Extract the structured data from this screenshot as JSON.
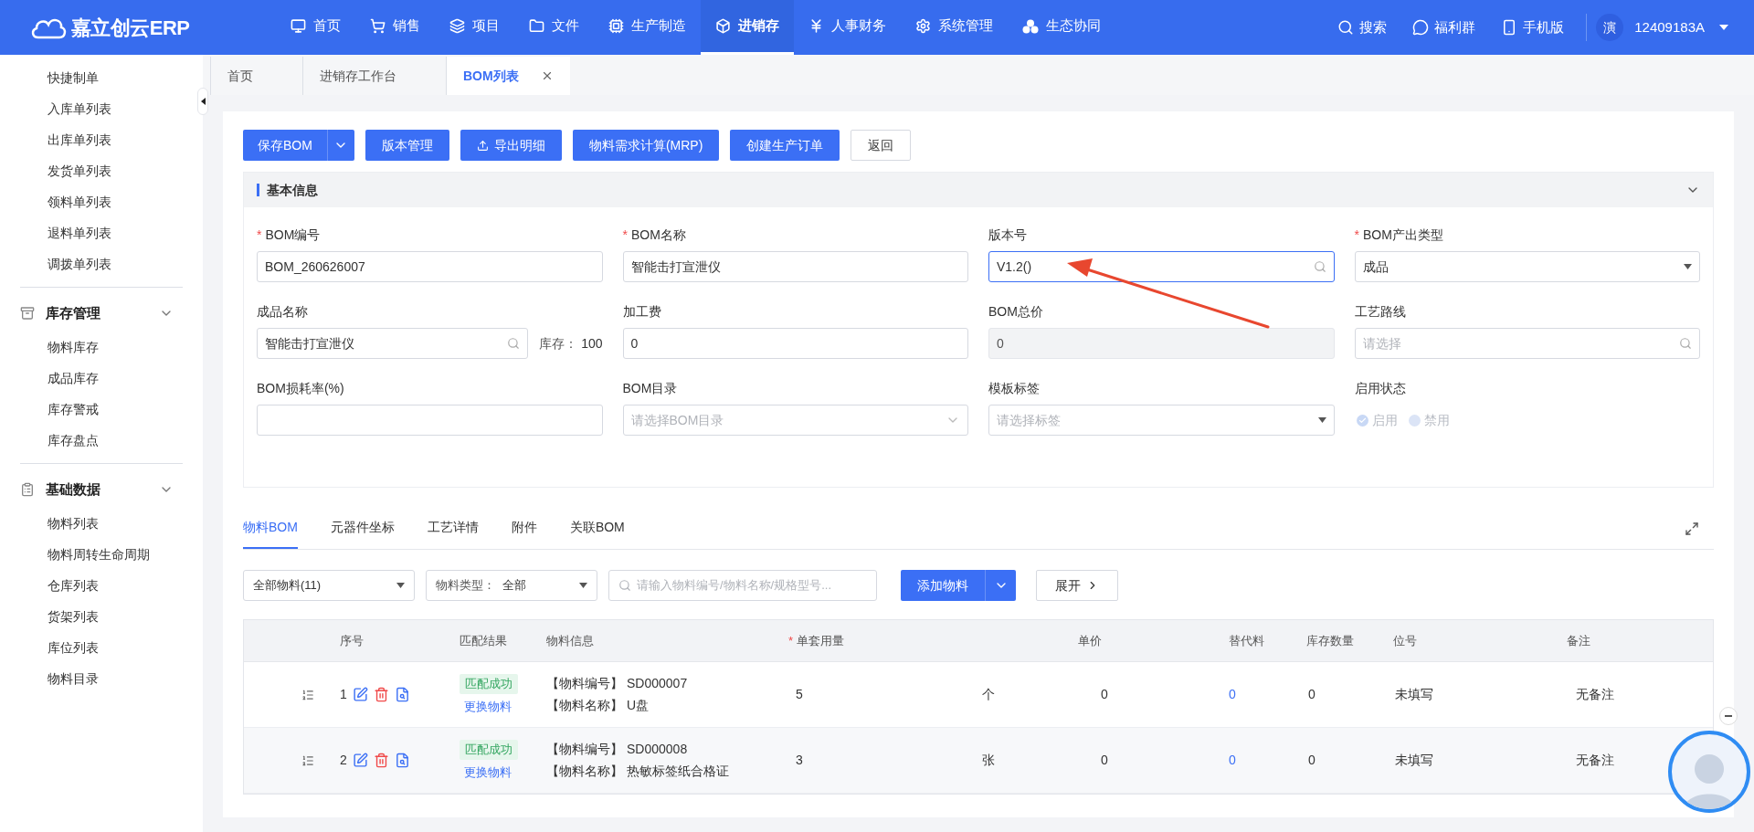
{
  "header": {
    "logo_text": "嘉立创云ERP",
    "nav": [
      {
        "label": "首页",
        "selected": false
      },
      {
        "label": "销售",
        "selected": false
      },
      {
        "label": "项目",
        "selected": false
      },
      {
        "label": "文件",
        "selected": false
      },
      {
        "label": "生产制造",
        "selected": false
      },
      {
        "label": "进销存",
        "selected": true
      },
      {
        "label": "人事财务",
        "selected": false
      },
      {
        "label": "系统管理",
        "selected": false
      },
      {
        "label": "生态协同",
        "selected": false
      }
    ],
    "tools": [
      "搜索",
      "福利群",
      "手机版"
    ],
    "user_avatar": "演",
    "user_name": "12409183A"
  },
  "sidebar": {
    "sections": [
      {
        "items": [
          "快捷制单",
          "入库单列表",
          "出库单列表",
          "发货单列表",
          "领料单列表",
          "退料单列表",
          "调拨单列表"
        ]
      },
      {
        "title": "库存管理",
        "expanded": true,
        "items": [
          "物料库存",
          "成品库存",
          "库存警戒",
          "库存盘点"
        ]
      },
      {
        "title": "基础数据",
        "expanded": true,
        "items": [
          "物料列表",
          "物料周转生命周期",
          "仓库列表",
          "货架列表",
          "库位列表",
          "物料目录"
        ]
      }
    ]
  },
  "page_tabs": [
    {
      "label": "首页",
      "selected": false,
      "closable": false
    },
    {
      "label": "进销存工作台",
      "selected": false,
      "closable": false
    },
    {
      "label": "BOM列表",
      "selected": true,
      "closable": true
    }
  ],
  "toolbar": [
    {
      "label": "保存BOM",
      "kind": "split"
    },
    {
      "label": "版本管理",
      "kind": "primary"
    },
    {
      "label": "导出明细",
      "kind": "export"
    },
    {
      "label": "物料需求计算(MRP)",
      "kind": "primary"
    },
    {
      "label": "创建生产订单",
      "kind": "primary"
    },
    {
      "label": "返回",
      "kind": "plain"
    }
  ],
  "basic_info": {
    "title": "基本信息",
    "expanded": true,
    "fields": [
      {
        "label": "BOM编号",
        "required_mark": "*",
        "kind": "text",
        "value": "BOM_260626007"
      },
      {
        "label": "BOM名称",
        "required_mark": "*",
        "kind": "text",
        "value": "智能击打宣泄仪"
      },
      {
        "label": "版本号",
        "kind": "search",
        "value": "V1.2()",
        "focused": true
      },
      {
        "label": "BOM产出类型",
        "required_mark": "*",
        "kind": "select",
        "value": "成品"
      },
      {
        "label": "成品名称",
        "kind": "stock",
        "value": "智能击打宣泄仪",
        "stock_label": "库存：",
        "stock_value": "100"
      },
      {
        "label": "加工费",
        "kind": "text",
        "value": "0"
      },
      {
        "label": "BOM总价",
        "kind": "readonly",
        "value": "0"
      },
      {
        "label": "工艺路线",
        "kind": "search",
        "placeholder": "请选择",
        "focused": false
      },
      {
        "label": "BOM损耗率(%)",
        "kind": "text"
      },
      {
        "label": "BOM目录",
        "kind": "dropdown",
        "placeholder": "请选择BOM目录"
      },
      {
        "label": "模板标签",
        "kind": "select",
        "placeholder": "请选择标签"
      },
      {
        "label": "启用状态",
        "kind": "radio",
        "options": [
          {
            "label": "启用",
            "selected": true
          },
          {
            "label": "禁用",
            "selected": false
          }
        ]
      }
    ]
  },
  "detail_tabs": [
    {
      "label": "物料BOM",
      "selected": true
    },
    {
      "label": "元器件坐标",
      "selected": false
    },
    {
      "label": "工艺详情",
      "selected": false
    },
    {
      "label": "附件",
      "selected": false
    },
    {
      "label": "关联BOM",
      "selected": false
    }
  ],
  "filters": {
    "material_filter": "全部物料(11)",
    "type_label": "物料类型：",
    "type_value": "全部",
    "search_placeholder": "请输入物料编号/物料名称/规格型号...",
    "add_button": "添加物料",
    "expand_button": "展开"
  },
  "table": {
    "columns": [
      {
        "label": "序号"
      },
      {
        "label": "匹配结果"
      },
      {
        "label": "物料信息"
      },
      {
        "label": "单套用量",
        "required_mark": "*"
      },
      {
        "label": "单价"
      },
      {
        "label": "替代料"
      },
      {
        "label": "库存数量"
      },
      {
        "label": "位号"
      },
      {
        "label": "备注"
      }
    ],
    "rows": [
      {
        "index": "1",
        "match": "匹配成功",
        "replace": "更换物料",
        "code_label": "【物料编号】",
        "code": "SD000007",
        "name_label": "【物料名称】",
        "name": "U盘",
        "qty": "5",
        "unit": "个",
        "price": "0",
        "substitutes": "0",
        "stock": "0",
        "position": "未填写",
        "note": "无备注"
      },
      {
        "index": "2",
        "match": "匹配成功",
        "replace": "更换物料",
        "code_label": "【物料编号】",
        "code": "SD000008",
        "name_label": "【物料名称】",
        "name": "热敏标签纸合格证",
        "qty": "3",
        "unit": "张",
        "price": "0",
        "substitutes": "0",
        "stock": "0",
        "position": "未填写",
        "note": "无备注"
      }
    ]
  }
}
